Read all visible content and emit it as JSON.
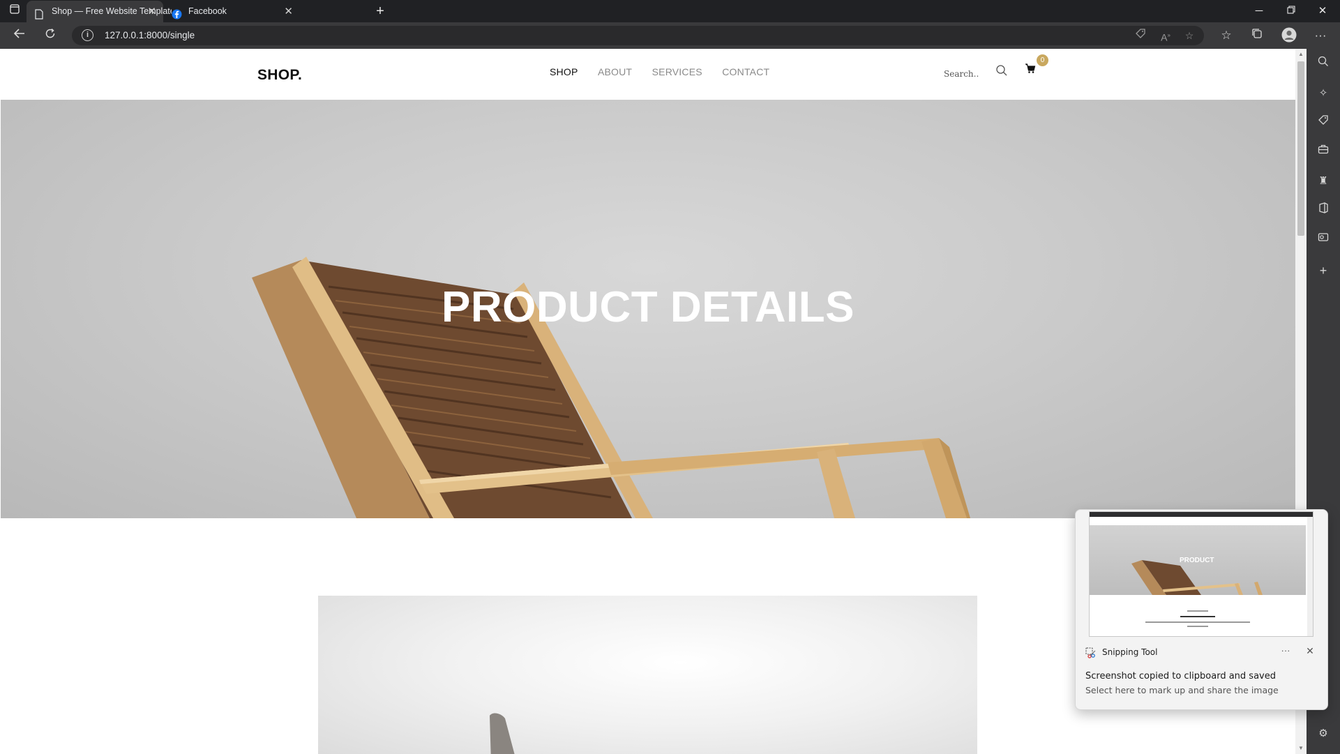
{
  "browser": {
    "tabs": [
      {
        "title": "Shop — Free Website Template,",
        "active": true
      },
      {
        "title": "Facebook",
        "active": false
      }
    ],
    "new_tab_label": "+",
    "url": "127.0.0.1:8000/single",
    "window_controls": [
      "minimize",
      "restore",
      "close"
    ]
  },
  "site": {
    "logo": "SHOP.",
    "nav": [
      {
        "label": "SHOP",
        "active": true
      },
      {
        "label": "ABOUT",
        "active": false
      },
      {
        "label": "SERVICES",
        "active": false
      },
      {
        "label": "CONTACT",
        "active": false
      }
    ],
    "search_placeholder": "Search..",
    "cart_count": "0",
    "hero_title": "PRODUCT DETAILS"
  },
  "toast": {
    "app_name": "Snipping Tool",
    "more_label": "···",
    "message": "Screenshot copied to clipboard and saved",
    "sub_message": "Select here to mark up and share the image",
    "thumbnail_title": "PRODUCT"
  },
  "colors": {
    "accent_badge": "#c9a85f",
    "browser_dark": "#3a3a3c",
    "hero_gray": "#cbcbcb"
  },
  "icons": {
    "sidebar": [
      "search-icon",
      "sparkle-icon",
      "tag-icon",
      "briefcase-icon",
      "games-icon",
      "office-icon",
      "outlook-icon",
      "add-icon"
    ],
    "omnibox": [
      "shopping-icon",
      "read-aloud-icon",
      "favorite-icon"
    ],
    "toolbar": [
      "favorites-icon",
      "collections-icon",
      "profile-icon",
      "more-icon"
    ]
  }
}
